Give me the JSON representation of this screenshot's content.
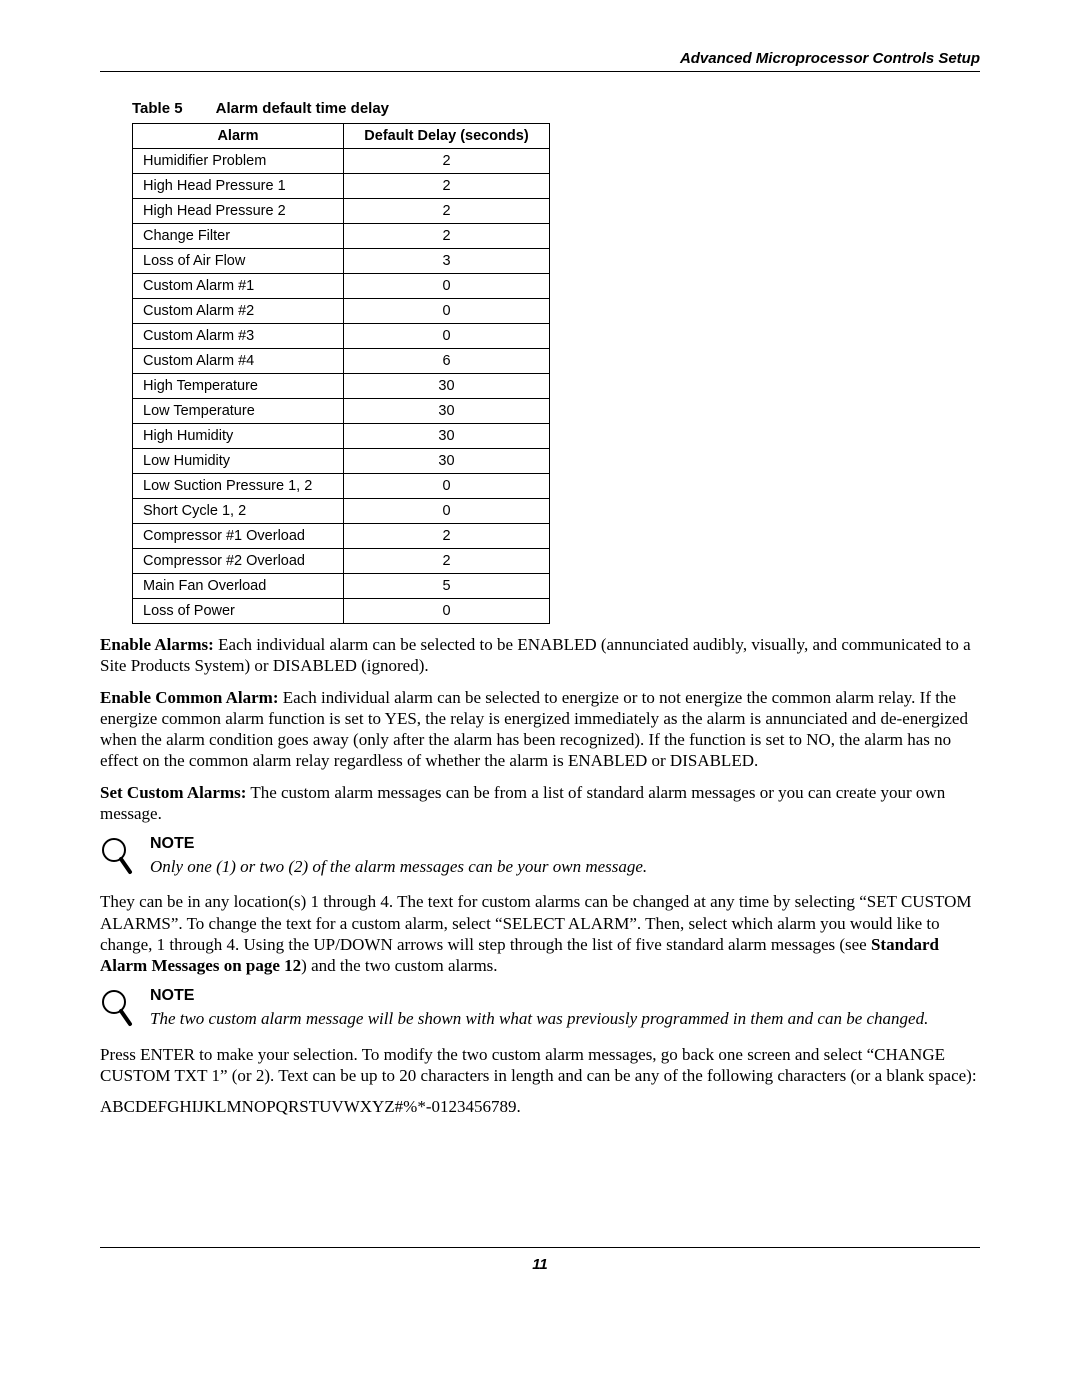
{
  "header": {
    "section_title": "Advanced Microprocessor Controls Setup"
  },
  "table_caption": {
    "label": "Table 5",
    "title": "Alarm default time delay"
  },
  "table": {
    "headers": {
      "col1": "Alarm",
      "col2": "Default Delay (seconds)"
    }
  },
  "chart_data": {
    "type": "table",
    "title": "Alarm default time delay",
    "columns": [
      "Alarm",
      "Default Delay (seconds)"
    ],
    "rows": [
      {
        "alarm": "Humidifier Problem",
        "delay": "2"
      },
      {
        "alarm": "High Head Pressure 1",
        "delay": "2"
      },
      {
        "alarm": "High Head Pressure 2",
        "delay": "2"
      },
      {
        "alarm": "Change Filter",
        "delay": "2"
      },
      {
        "alarm": "Loss of Air Flow",
        "delay": "3"
      },
      {
        "alarm": "Custom Alarm #1",
        "delay": "0"
      },
      {
        "alarm": "Custom Alarm #2",
        "delay": "0"
      },
      {
        "alarm": "Custom Alarm #3",
        "delay": "0"
      },
      {
        "alarm": "Custom Alarm #4",
        "delay": "6"
      },
      {
        "alarm": "High Temperature",
        "delay": "30"
      },
      {
        "alarm": "Low Temperature",
        "delay": "30"
      },
      {
        "alarm": "High Humidity",
        "delay": "30"
      },
      {
        "alarm": "Low Humidity",
        "delay": "30"
      },
      {
        "alarm": "Low Suction Pressure 1, 2",
        "delay": "0"
      },
      {
        "alarm": "Short Cycle 1, 2",
        "delay": "0"
      },
      {
        "alarm": "Compressor #1 Overload",
        "delay": "2"
      },
      {
        "alarm": "Compressor #2 Overload",
        "delay": "2"
      },
      {
        "alarm": "Main Fan Overload",
        "delay": "5"
      },
      {
        "alarm": "Loss of Power",
        "delay": "0"
      }
    ]
  },
  "paragraphs": {
    "enable_alarms_label": "Enable Alarms:",
    "enable_alarms_text": " Each individual alarm can be selected to be ENABLED (annunciated audibly, visually, and communicated to a Site Products System) or DISABLED (ignored).",
    "enable_common_label": "Enable Common Alarm:",
    "enable_common_text": " Each individual alarm can be selected to energize or to not energize the common alarm relay. If the energize common alarm function is set to YES, the relay is energized immediately as the alarm is annunciated and de-energized when the alarm condition goes away (only after the alarm has been recognized). If the function is set to NO, the alarm has no effect on the common alarm relay regardless of whether the alarm is ENABLED or DISABLED.",
    "set_custom_label": "Set Custom Alarms:",
    "set_custom_text": " The custom alarm messages can be from a list of standard alarm messages or you can create your own message.",
    "note1_heading": "NOTE",
    "note1_text": "Only one (1) or two (2) of the alarm messages can be your own message.",
    "custom_location_pre": "They can be in any location(s) 1 through 4. The text for custom alarms can be changed at any time by selecting “SET CUSTOM ALARMS”. To change the text for a custom alarm, select “SELECT ALARM”. Then, select which alarm you would like to change, 1 through 4. Using the UP/DOWN arrows will step through the list of five standard alarm messages (see ",
    "custom_location_bold": "Standard Alarm Messages on page 12",
    "custom_location_post": ") and the two custom alarms.",
    "note2_heading": "NOTE",
    "note2_text": "The two custom alarm message will be shown with what was previously programmed in them and can be changed.",
    "press_enter": "Press ENTER to make your selection. To modify the two custom alarm messages, go back one screen and select “CHANGE CUSTOM TXT 1” (or 2). Text can be up to 20 characters in length and can be any of the following characters (or a blank space):",
    "charset": "ABCDEFGHIJKLMNOPQRSTUVWXYZ#%*-0123456789."
  },
  "footer": {
    "page_number": "11"
  }
}
